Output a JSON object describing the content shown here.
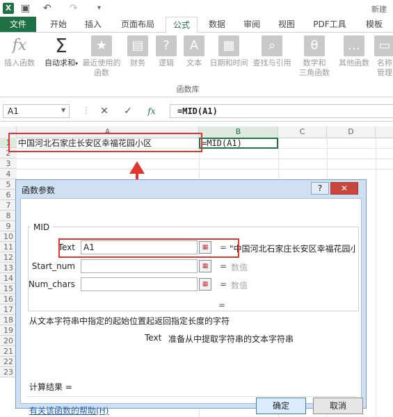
{
  "window": {
    "title_partial": "新建"
  },
  "tabs": [
    "文件",
    "开始",
    "插入",
    "页面布局",
    "公式",
    "数据",
    "审阅",
    "视图",
    "PDF工具",
    "模板"
  ],
  "active_tab": "公式",
  "ribbon": {
    "insert_function": "插入函数",
    "autosum": "自动求和",
    "recent_1": "最近使用的",
    "recent_2": "函数",
    "financial": "财务",
    "logical": "逻辑",
    "text": "文本",
    "datetime": "日期和时间",
    "lookup": "查找与引用",
    "math_1": "数学和",
    "math_2": "三角函数",
    "other": "其他函数",
    "name_mgr_1": "名称",
    "name_mgr_2": "管理",
    "group_label": "函数库"
  },
  "formula_bar": {
    "name_box": "A1",
    "fx": "fx",
    "formula": "=MID(A1)"
  },
  "columns": [
    "A",
    "B",
    "C",
    "D"
  ],
  "rows": [
    "1",
    "2",
    "3",
    "4",
    "5",
    "6",
    "7",
    "8",
    "9",
    "10",
    "11",
    "12",
    "13",
    "14",
    "15",
    "16",
    "17",
    "18",
    "19",
    "20",
    "21",
    "22",
    "23"
  ],
  "cells": {
    "A1": "中国河北石家庄长安区幸福花园小区",
    "B1": "=MID(A1)"
  },
  "dialog": {
    "title": "函数参数",
    "help_btn": "?",
    "close_btn": "✕",
    "function_name": "MID",
    "args": [
      {
        "label": "Text",
        "value": "A1",
        "eq": "=",
        "result": "\"中国河北石家庄长安区幸福花园小"
      },
      {
        "label": "Start_num",
        "value": "",
        "eq": "=",
        "result": "数值"
      },
      {
        "label": "Num_chars",
        "value": "",
        "eq": "=",
        "result": "数值"
      }
    ],
    "result_eq": "=",
    "description": "从文本字符串中指定的起始位置起返回指定长度的字符",
    "arg_desc_label": "Text",
    "arg_desc_text": "准备从中提取字符串的文本字符串",
    "calc_result": "计算结果 =",
    "help_link": "有关该函数的帮助(H)",
    "ok": "确定",
    "cancel": "取消"
  },
  "colors": {
    "excel_green": "#1e7145",
    "highlight_red": "#e3352f",
    "dialog_bg": "#cfe0f3"
  }
}
